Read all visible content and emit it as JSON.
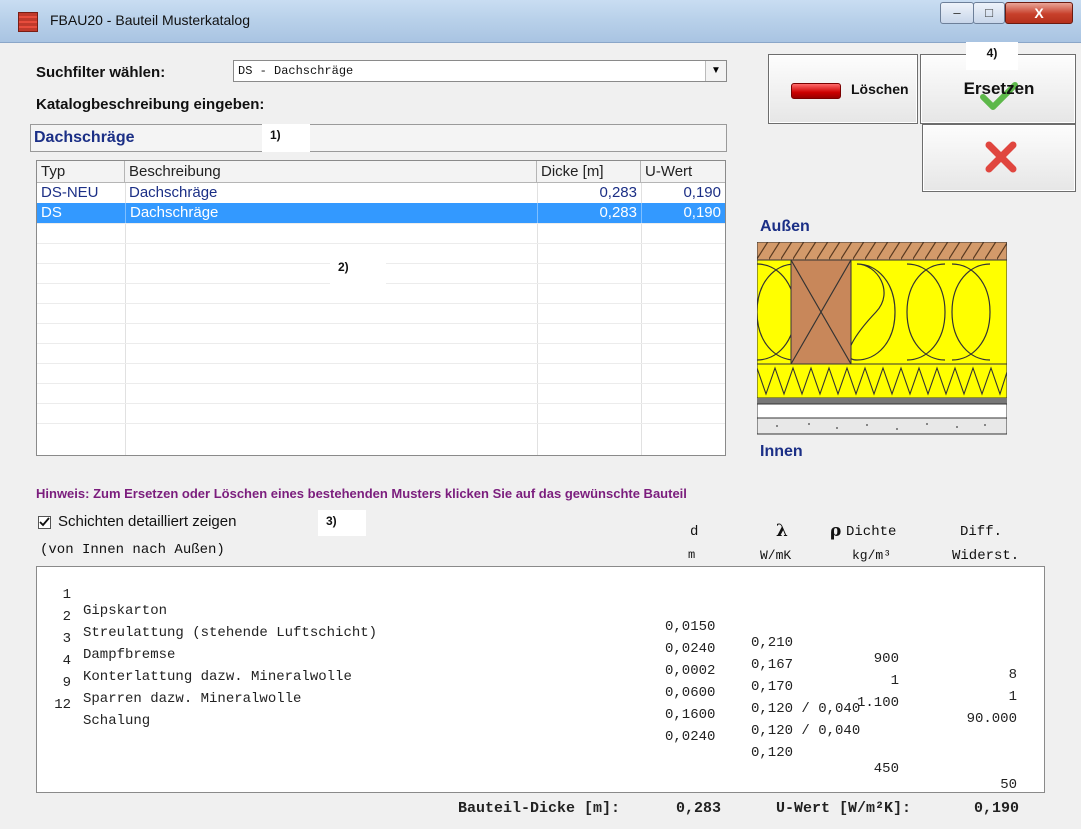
{
  "window": {
    "title": "FBAU20 - Bauteil Musterkatalog",
    "min": "–",
    "max": "□",
    "close": "X"
  },
  "filter": {
    "label": "Suchfilter wählen:",
    "value": "DS - Dachschräge",
    "arrow": "▼"
  },
  "description": {
    "label": "Katalogbeschreibung eingeben:",
    "value": "Dachschräge"
  },
  "markers": {
    "m1": "1)",
    "m2": "2)",
    "m3": "3)",
    "m4": "4)"
  },
  "catalog": {
    "columns": [
      "Typ",
      "Beschreibung",
      "Dicke [m]",
      "U-Wert"
    ],
    "rows": [
      {
        "typ": "DS-NEU",
        "beschreibung": "Dachschräge",
        "dicke": "0,283",
        "uwert": "0,190"
      },
      {
        "typ": "DS",
        "beschreibung": "Dachschräge",
        "dicke": "0,283",
        "uwert": "0,190"
      }
    ]
  },
  "buttons": {
    "loeschen": "Löschen",
    "ersetzen": "Ersetzen"
  },
  "diagram": {
    "top_label": "Außen",
    "bottom_label": "Innen"
  },
  "hint": "Hinweis: Zum Ersetzen oder Löschen eines bestehenden Musters klicken Sie auf das gewünschte Bauteil",
  "layers": {
    "checkbox_label": "Schichten detailliert zeigen",
    "checked": true,
    "order_label": "(von Innen nach Außen)",
    "headers": {
      "d": "d",
      "d_unit": "m",
      "lambda": "λ",
      "lambda_unit": "W/mK",
      "rho": "ρ",
      "rho_label": "Dichte",
      "rho_unit": "kg/m³",
      "diff": "Diff.",
      "diff_unit": "Widerst."
    },
    "rows": [
      {
        "nr": " 1",
        "name": "Gipskarton",
        "d": "0,0150",
        "lambda": "0,210",
        "rho": "900",
        "diff": "8"
      },
      {
        "nr": " 2",
        "name": "Streulattung (stehende Luftschicht)",
        "d": "0,0240",
        "lambda": "0,167",
        "rho": "1",
        "diff": "1"
      },
      {
        "nr": " 3",
        "name": "Dampfbremse",
        "d": "0,0002",
        "lambda": "0,170",
        "rho": "1.100",
        "diff": "90.000"
      },
      {
        "nr": " 4",
        "name": "Konterlattung dazw. Mineralwolle",
        "d": "0,0600",
        "lambda": "0,120 / 0,040",
        "rho": "",
        "diff": ""
      },
      {
        "nr": " 9",
        "name": "Sparren dazw. Mineralwolle",
        "d": "0,1600",
        "lambda": "0,120 / 0,040",
        "rho": "",
        "diff": ""
      },
      {
        "nr": "12",
        "name": "Schalung",
        "d": "0,0240",
        "lambda": "0,120",
        "rho": "450",
        "diff": "50"
      }
    ]
  },
  "footer": {
    "thickness_label": "Bauteil-Dicke [m]:",
    "thickness_value": "0,283",
    "uwert_label": "U-Wert [W/m²K]:",
    "uwert_value": "0,190"
  },
  "colors": {
    "selection": "#3399ff",
    "hint": "#7b1d7d",
    "description_text": "#1b2f86",
    "insulation": "#ffff00",
    "timber": "#c8875a"
  }
}
